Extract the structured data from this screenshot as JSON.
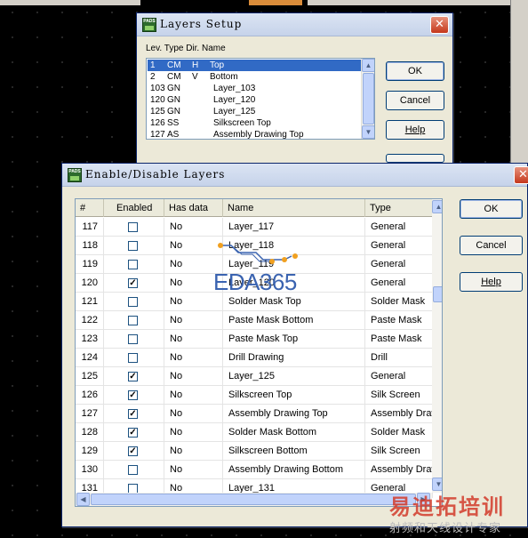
{
  "layers_setup": {
    "title": "Layers Setup",
    "icon_label": "PADS",
    "column_header": "Lev. Type Dir. Name",
    "rows": [
      {
        "lev": "1",
        "type": "CM",
        "dir": "H",
        "name": "Top"
      },
      {
        "lev": "2",
        "type": "CM",
        "dir": "V",
        "name": "Bottom"
      },
      {
        "lev": "103",
        "type": "GN",
        "dir": "",
        "name": "Layer_103"
      },
      {
        "lev": "120",
        "type": "GN",
        "dir": "",
        "name": "Layer_120"
      },
      {
        "lev": "125",
        "type": "GN",
        "dir": "",
        "name": "Layer_125"
      },
      {
        "lev": "126",
        "type": "SS",
        "dir": "",
        "name": "Silkscreen Top"
      },
      {
        "lev": "127",
        "type": "AS",
        "dir": "",
        "name": "Assembly Drawing Top"
      }
    ],
    "buttons": {
      "ok": "OK",
      "cancel": "Cancel",
      "help": "Help"
    }
  },
  "enable_disable": {
    "title": "Enable/Disable Layers",
    "icon_label": "PADS",
    "columns": {
      "num": "#",
      "enabled": "Enabled",
      "has_data": "Has data",
      "name": "Name",
      "type": "Type"
    },
    "rows": [
      {
        "num": "117",
        "enabled": false,
        "has_data": "No",
        "name": "Layer_117",
        "type": "General"
      },
      {
        "num": "118",
        "enabled": false,
        "has_data": "No",
        "name": "Layer_118",
        "type": "General"
      },
      {
        "num": "119",
        "enabled": false,
        "has_data": "No",
        "name": "Layer_119",
        "type": "General"
      },
      {
        "num": "120",
        "enabled": true,
        "has_data": "No",
        "name": "Layer_120",
        "type": "General"
      },
      {
        "num": "121",
        "enabled": false,
        "has_data": "No",
        "name": "Solder Mask Top",
        "type": "Solder Mask"
      },
      {
        "num": "122",
        "enabled": false,
        "has_data": "No",
        "name": "Paste Mask Bottom",
        "type": "Paste Mask"
      },
      {
        "num": "123",
        "enabled": false,
        "has_data": "No",
        "name": "Paste Mask Top",
        "type": "Paste Mask"
      },
      {
        "num": "124",
        "enabled": false,
        "has_data": "No",
        "name": "Drill Drawing",
        "type": "Drill"
      },
      {
        "num": "125",
        "enabled": true,
        "has_data": "No",
        "name": "Layer_125",
        "type": "General"
      },
      {
        "num": "126",
        "enabled": true,
        "has_data": "No",
        "name": "Silkscreen Top",
        "type": "Silk Screen"
      },
      {
        "num": "127",
        "enabled": true,
        "has_data": "No",
        "name": "Assembly Drawing Top",
        "type": "Assembly Draw"
      },
      {
        "num": "128",
        "enabled": true,
        "has_data": "No",
        "name": "Solder Mask Bottom",
        "type": "Solder Mask"
      },
      {
        "num": "129",
        "enabled": true,
        "has_data": "No",
        "name": "Silkscreen Bottom",
        "type": "Silk Screen"
      },
      {
        "num": "130",
        "enabled": false,
        "has_data": "No",
        "name": "Assembly Drawing Bottom",
        "type": "Assembly Draw"
      },
      {
        "num": "131",
        "enabled": false,
        "has_data": "No",
        "name": "Layer_131",
        "type": "General"
      }
    ],
    "buttons": {
      "ok": "OK",
      "cancel": "Cancel",
      "help": "Help"
    }
  },
  "watermark": {
    "eda": "EDA365",
    "brand_big": "易迪拓培训",
    "brand_small": "射频和天线设计专家"
  },
  "colors": {
    "selection": "#316ac5",
    "title_bar": "#c6d3ea",
    "close_button": "#c4371c"
  }
}
